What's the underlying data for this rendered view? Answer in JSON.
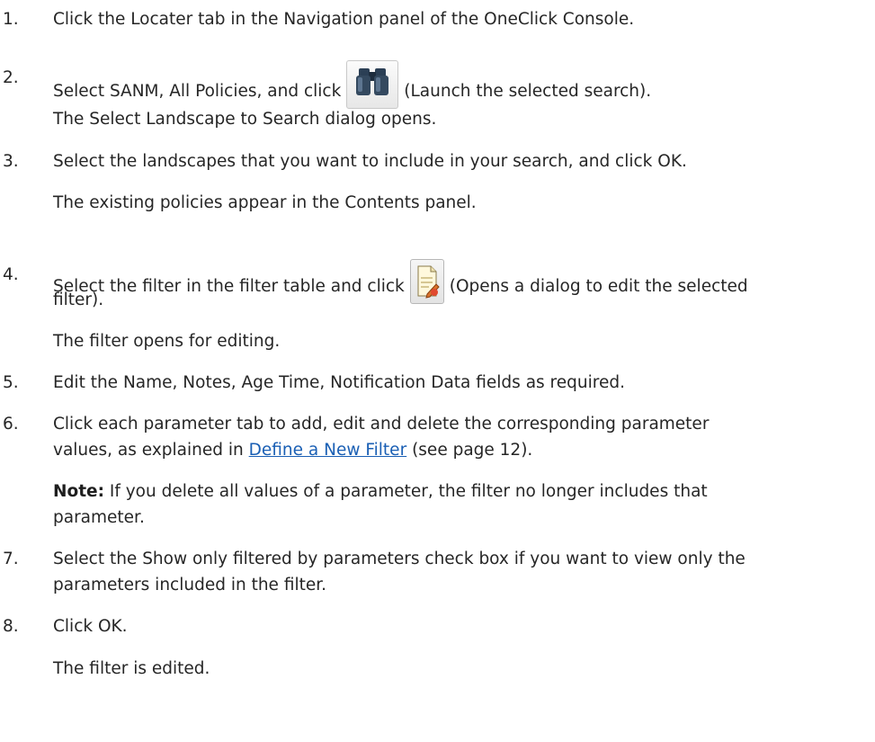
{
  "steps": [
    {
      "num": "1.",
      "text": "Click the Locater tab in the Navigation panel of the OneClick Console."
    },
    {
      "num": "2.",
      "pre": "Select SANM, All Policies, and click",
      "post": "(Launch the selected search).",
      "icon": "binoculars-icon",
      "after": "The Select Landscape to Search dialog opens."
    },
    {
      "num": "3.",
      "text": "Select the landscapes that you want to include in your search, and click OK.",
      "after": "The existing policies appear in the Contents panel."
    },
    {
      "num": "4.",
      "pre": "Select the filter in the filter table and click",
      "post": "(Opens a dialog to edit the selected",
      "cont": "filter).",
      "icon": "edit-filter-icon",
      "after": "The filter opens for editing."
    },
    {
      "num": "5.",
      "text": "Edit the Name, Notes, Age Time, Notification Data fields as required."
    },
    {
      "num": "6.",
      "text": "Click each parameter tab to add, edit and delete the corresponding parameter",
      "cont_pre": "values, as explained in",
      "link": "Define a New Filter",
      "cont_post": "(see page 12).",
      "note_label": "Note:",
      "note_text": "If you delete all values of a parameter, the filter no longer includes that",
      "note_cont": "parameter."
    },
    {
      "num": "7.",
      "text": "Select the Show only filtered by parameters check box if you want to view only the",
      "cont": "parameters included in the filter."
    },
    {
      "num": "8.",
      "text": "Click OK.",
      "after": "The filter is edited."
    }
  ],
  "colors": {
    "text": "#262626",
    "link": "#1a5fb4"
  }
}
